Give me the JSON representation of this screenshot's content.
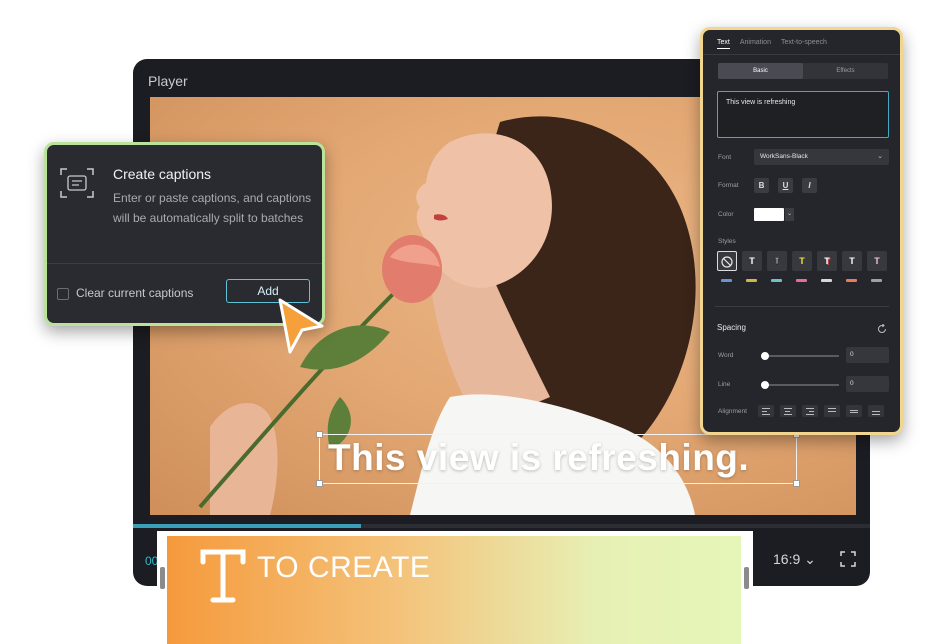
{
  "player": {
    "title": "Player",
    "time": "00",
    "aspect_ratio": "16:9 ⌄",
    "progress_fraction": 0.31,
    "caption_text": "This view is refreshing."
  },
  "captions_popup": {
    "title": "Create captions",
    "description": "Enter or paste captions, and captions will be automatically split to batches",
    "checkbox_label": "Clear current captions",
    "add_label": "Add"
  },
  "text_panel": {
    "tabs": [
      "Text",
      "Animation",
      "Text-to-speech"
    ],
    "segments": [
      "Basic",
      "Effects"
    ],
    "text_value": "This view is refreshing",
    "font_label": "Font",
    "font_value": "WorkSans-Black",
    "format_label": "Format",
    "format_buttons": [
      "B",
      "U",
      "I"
    ],
    "color_label": "Color",
    "styles_label": "Styles",
    "styles": [
      "T",
      "T",
      "T",
      "T",
      "T",
      "T"
    ],
    "spacing_label": "Spacing",
    "word_label": "Word",
    "word_value": "0",
    "line_label": "Line",
    "line_value": "0",
    "alignment_label": "Alignment"
  },
  "banner": {
    "text": "TO CREATE"
  },
  "colors": {
    "caption_popup_border": "#b9e39a",
    "text_panel_border": "#f2d58e",
    "accent": "#45a9c3",
    "cursor": "#f5a03a"
  }
}
